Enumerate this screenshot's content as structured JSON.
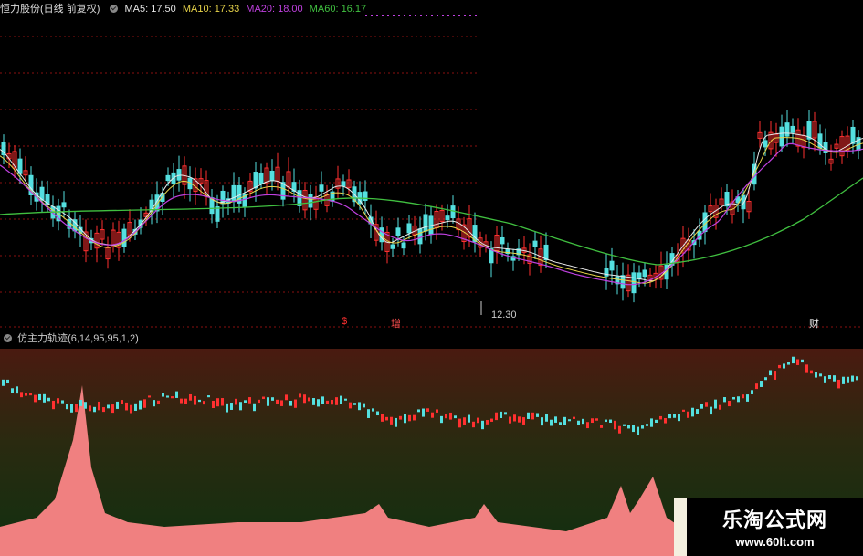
{
  "window_title": "恒力股份(日线 前复权)",
  "legend": [
    {
      "label": "MA5: 17.50",
      "color": "#e8e8e8"
    },
    {
      "label": "MA10: 17.33",
      "color": "#e8d44a"
    },
    {
      "label": "MA20: 18.00",
      "color": "#c040e0"
    },
    {
      "label": "MA60: 16.17",
      "color": "#40c040"
    }
  ],
  "price_annotation": "12.30",
  "markers": [
    "$",
    "增",
    "财"
  ],
  "indicator_title": "仿主力轨迹(6,14,95,95,1,2)",
  "watermark": {
    "title": "乐淘公式网",
    "url": "www.60lt.com"
  },
  "colors": {
    "up": "#ff3030",
    "down": "#54e0e0",
    "ma5": "#e8e8e8",
    "ma10": "#e8d44a",
    "ma20": "#c040e0",
    "ma60": "#40c040",
    "grid": "#8a1010",
    "mountain": "#f08080"
  }
}
